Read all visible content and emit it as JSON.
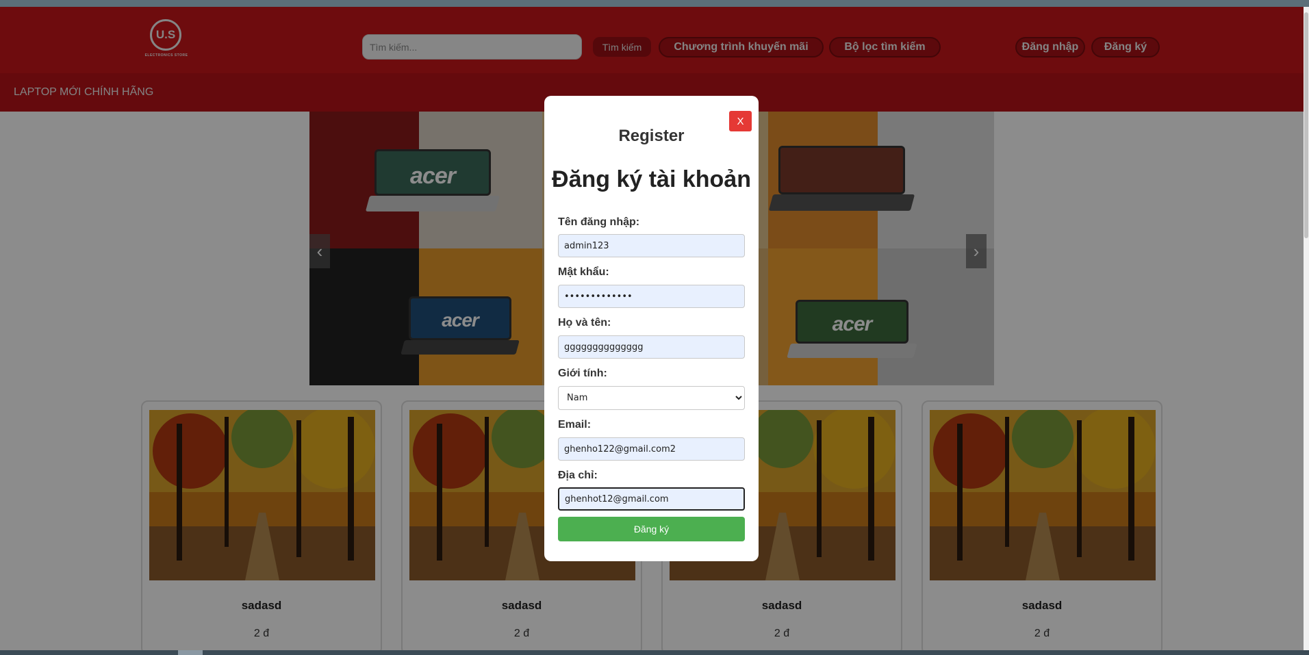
{
  "header": {
    "logo_text": "U.S",
    "logo_subtitle": "ELECTRONICS STORE",
    "search_placeholder": "Tìm kiếm...",
    "search_button": "Tìm kiếm",
    "promo_button": "Chương trình khuyến mãi",
    "filter_button": "Bộ lọc tìm kiếm",
    "login_button": "Đăng nhập",
    "register_button": "Đăng ký"
  },
  "nav": {
    "item": "LAPTOP MỚI CHÍNH HÃNG"
  },
  "carousel": {
    "prev": "‹",
    "next": "›",
    "brand": "acer"
  },
  "products": [
    {
      "name": "sadasd",
      "price": "2 đ"
    },
    {
      "name": "sadasd",
      "price": "2 đ"
    },
    {
      "name": "sadasd",
      "price": "2 đ"
    },
    {
      "name": "sadasd",
      "price": "2 đ"
    }
  ],
  "modal": {
    "close": "X",
    "title": "Register",
    "heading": "Đăng ký tài khoản",
    "username_label": "Tên đăng nhập:",
    "username_value": "admin123",
    "password_label": "Mật khẩu:",
    "password_value": "•••••••••••••",
    "fullname_label": "Họ và tên:",
    "fullname_value": "gggggggggggggg",
    "gender_label": "Giới tính:",
    "gender_value": "Nam",
    "email_label": "Email:",
    "email_value": "ghenho122@gmail.com2",
    "address_label": "Địa chỉ:",
    "address_value": "ghenhot12@gmail.com",
    "submit": "Đăng ký"
  },
  "colors": {
    "header": "#c9161b",
    "navbar": "#b81318",
    "submit": "#4caf50",
    "close": "#e53935"
  }
}
